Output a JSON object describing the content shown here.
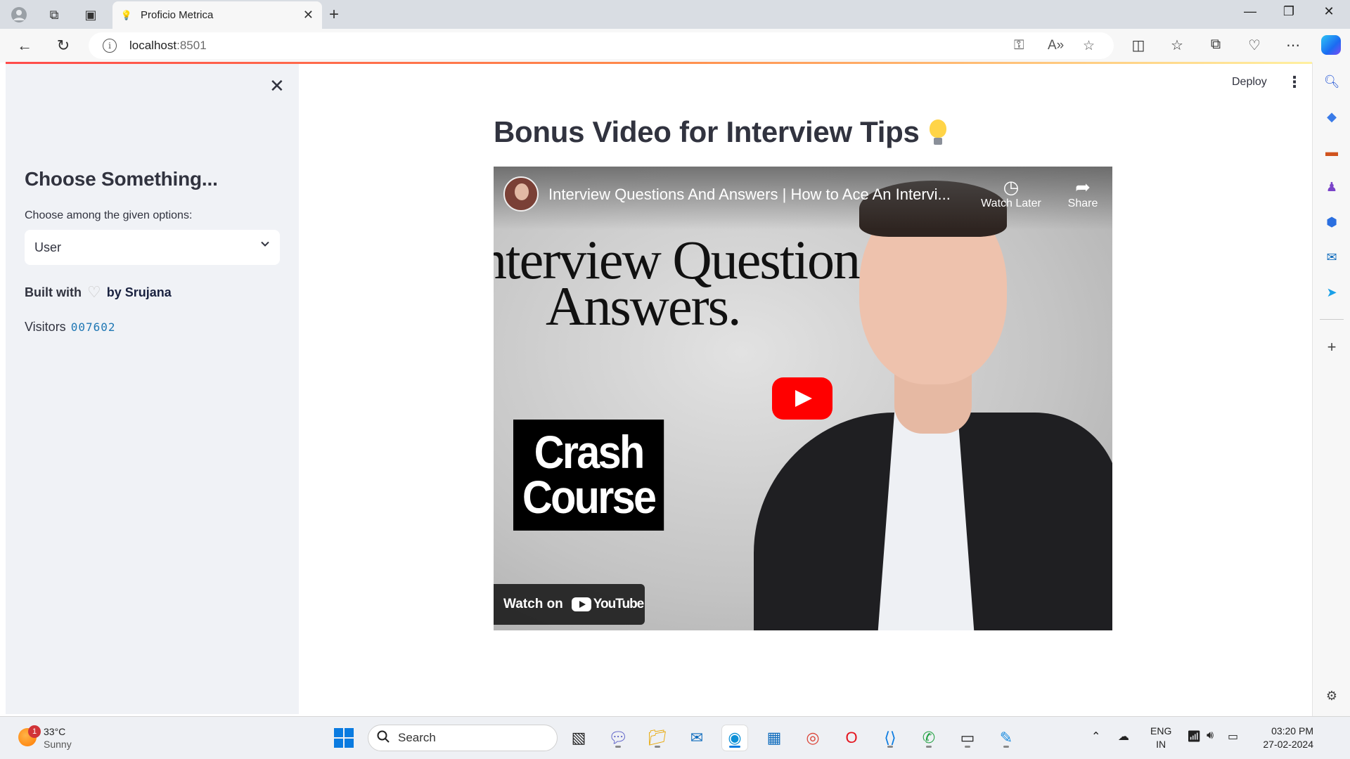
{
  "browser": {
    "tab_title": "Proficio Metrica",
    "url_host": "localhost",
    "url_port": ":8501"
  },
  "sidebar": {
    "heading": "Choose Something...",
    "select_label": "Choose among the given options:",
    "select_value": "User",
    "built_with": "Built with",
    "by_author": "by Srujana",
    "visitors_label": "Visitors",
    "visitors_count": "007602"
  },
  "main": {
    "deploy_label": "Deploy",
    "title": "Bonus Video for Interview Tips",
    "video": {
      "title": "Interview Questions And Answers | How to Ace An Intervi...",
      "watch_later": "Watch Later",
      "share": "Share",
      "headline_line1": "nterview Question",
      "headline_line2": "Answers.",
      "crash_line1": "Crash",
      "crash_line2": "Course",
      "watch_on": "Watch on",
      "youtube": "YouTube"
    }
  },
  "taskbar": {
    "weather_temp": "33°C",
    "weather_desc": "Sunny",
    "weather_badge": "1",
    "search_placeholder": "Search",
    "lang_line1": "ENG",
    "lang_line2": "IN",
    "time": "03:20 PM",
    "date": "27-02-2024"
  },
  "colors": {
    "accent_red": "#ff4b4b",
    "sidebar_bg": "#f0f2f6",
    "text": "#31333f",
    "visitor_count": "#1f77b4"
  }
}
